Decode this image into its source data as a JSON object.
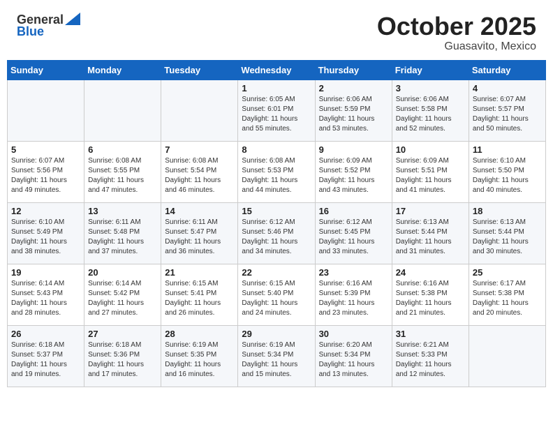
{
  "header": {
    "logo_line1": "General",
    "logo_line2": "Blue",
    "month": "October 2025",
    "location": "Guasavito, Mexico"
  },
  "weekdays": [
    "Sunday",
    "Monday",
    "Tuesday",
    "Wednesday",
    "Thursday",
    "Friday",
    "Saturday"
  ],
  "weeks": [
    [
      {
        "day": "",
        "sunrise": "",
        "sunset": "",
        "daylight": ""
      },
      {
        "day": "",
        "sunrise": "",
        "sunset": "",
        "daylight": ""
      },
      {
        "day": "",
        "sunrise": "",
        "sunset": "",
        "daylight": ""
      },
      {
        "day": "1",
        "sunrise": "Sunrise: 6:05 AM",
        "sunset": "Sunset: 6:01 PM",
        "daylight": "Daylight: 11 hours and 55 minutes."
      },
      {
        "day": "2",
        "sunrise": "Sunrise: 6:06 AM",
        "sunset": "Sunset: 5:59 PM",
        "daylight": "Daylight: 11 hours and 53 minutes."
      },
      {
        "day": "3",
        "sunrise": "Sunrise: 6:06 AM",
        "sunset": "Sunset: 5:58 PM",
        "daylight": "Daylight: 11 hours and 52 minutes."
      },
      {
        "day": "4",
        "sunrise": "Sunrise: 6:07 AM",
        "sunset": "Sunset: 5:57 PM",
        "daylight": "Daylight: 11 hours and 50 minutes."
      }
    ],
    [
      {
        "day": "5",
        "sunrise": "Sunrise: 6:07 AM",
        "sunset": "Sunset: 5:56 PM",
        "daylight": "Daylight: 11 hours and 49 minutes."
      },
      {
        "day": "6",
        "sunrise": "Sunrise: 6:08 AM",
        "sunset": "Sunset: 5:55 PM",
        "daylight": "Daylight: 11 hours and 47 minutes."
      },
      {
        "day": "7",
        "sunrise": "Sunrise: 6:08 AM",
        "sunset": "Sunset: 5:54 PM",
        "daylight": "Daylight: 11 hours and 46 minutes."
      },
      {
        "day": "8",
        "sunrise": "Sunrise: 6:08 AM",
        "sunset": "Sunset: 5:53 PM",
        "daylight": "Daylight: 11 hours and 44 minutes."
      },
      {
        "day": "9",
        "sunrise": "Sunrise: 6:09 AM",
        "sunset": "Sunset: 5:52 PM",
        "daylight": "Daylight: 11 hours and 43 minutes."
      },
      {
        "day": "10",
        "sunrise": "Sunrise: 6:09 AM",
        "sunset": "Sunset: 5:51 PM",
        "daylight": "Daylight: 11 hours and 41 minutes."
      },
      {
        "day": "11",
        "sunrise": "Sunrise: 6:10 AM",
        "sunset": "Sunset: 5:50 PM",
        "daylight": "Daylight: 11 hours and 40 minutes."
      }
    ],
    [
      {
        "day": "12",
        "sunrise": "Sunrise: 6:10 AM",
        "sunset": "Sunset: 5:49 PM",
        "daylight": "Daylight: 11 hours and 38 minutes."
      },
      {
        "day": "13",
        "sunrise": "Sunrise: 6:11 AM",
        "sunset": "Sunset: 5:48 PM",
        "daylight": "Daylight: 11 hours and 37 minutes."
      },
      {
        "day": "14",
        "sunrise": "Sunrise: 6:11 AM",
        "sunset": "Sunset: 5:47 PM",
        "daylight": "Daylight: 11 hours and 36 minutes."
      },
      {
        "day": "15",
        "sunrise": "Sunrise: 6:12 AM",
        "sunset": "Sunset: 5:46 PM",
        "daylight": "Daylight: 11 hours and 34 minutes."
      },
      {
        "day": "16",
        "sunrise": "Sunrise: 6:12 AM",
        "sunset": "Sunset: 5:45 PM",
        "daylight": "Daylight: 11 hours and 33 minutes."
      },
      {
        "day": "17",
        "sunrise": "Sunrise: 6:13 AM",
        "sunset": "Sunset: 5:44 PM",
        "daylight": "Daylight: 11 hours and 31 minutes."
      },
      {
        "day": "18",
        "sunrise": "Sunrise: 6:13 AM",
        "sunset": "Sunset: 5:44 PM",
        "daylight": "Daylight: 11 hours and 30 minutes."
      }
    ],
    [
      {
        "day": "19",
        "sunrise": "Sunrise: 6:14 AM",
        "sunset": "Sunset: 5:43 PM",
        "daylight": "Daylight: 11 hours and 28 minutes."
      },
      {
        "day": "20",
        "sunrise": "Sunrise: 6:14 AM",
        "sunset": "Sunset: 5:42 PM",
        "daylight": "Daylight: 11 hours and 27 minutes."
      },
      {
        "day": "21",
        "sunrise": "Sunrise: 6:15 AM",
        "sunset": "Sunset: 5:41 PM",
        "daylight": "Daylight: 11 hours and 26 minutes."
      },
      {
        "day": "22",
        "sunrise": "Sunrise: 6:15 AM",
        "sunset": "Sunset: 5:40 PM",
        "daylight": "Daylight: 11 hours and 24 minutes."
      },
      {
        "day": "23",
        "sunrise": "Sunrise: 6:16 AM",
        "sunset": "Sunset: 5:39 PM",
        "daylight": "Daylight: 11 hours and 23 minutes."
      },
      {
        "day": "24",
        "sunrise": "Sunrise: 6:16 AM",
        "sunset": "Sunset: 5:38 PM",
        "daylight": "Daylight: 11 hours and 21 minutes."
      },
      {
        "day": "25",
        "sunrise": "Sunrise: 6:17 AM",
        "sunset": "Sunset: 5:38 PM",
        "daylight": "Daylight: 11 hours and 20 minutes."
      }
    ],
    [
      {
        "day": "26",
        "sunrise": "Sunrise: 6:18 AM",
        "sunset": "Sunset: 5:37 PM",
        "daylight": "Daylight: 11 hours and 19 minutes."
      },
      {
        "day": "27",
        "sunrise": "Sunrise: 6:18 AM",
        "sunset": "Sunset: 5:36 PM",
        "daylight": "Daylight: 11 hours and 17 minutes."
      },
      {
        "day": "28",
        "sunrise": "Sunrise: 6:19 AM",
        "sunset": "Sunset: 5:35 PM",
        "daylight": "Daylight: 11 hours and 16 minutes."
      },
      {
        "day": "29",
        "sunrise": "Sunrise: 6:19 AM",
        "sunset": "Sunset: 5:34 PM",
        "daylight": "Daylight: 11 hours and 15 minutes."
      },
      {
        "day": "30",
        "sunrise": "Sunrise: 6:20 AM",
        "sunset": "Sunset: 5:34 PM",
        "daylight": "Daylight: 11 hours and 13 minutes."
      },
      {
        "day": "31",
        "sunrise": "Sunrise: 6:21 AM",
        "sunset": "Sunset: 5:33 PM",
        "daylight": "Daylight: 11 hours and 12 minutes."
      },
      {
        "day": "",
        "sunrise": "",
        "sunset": "",
        "daylight": ""
      }
    ]
  ]
}
